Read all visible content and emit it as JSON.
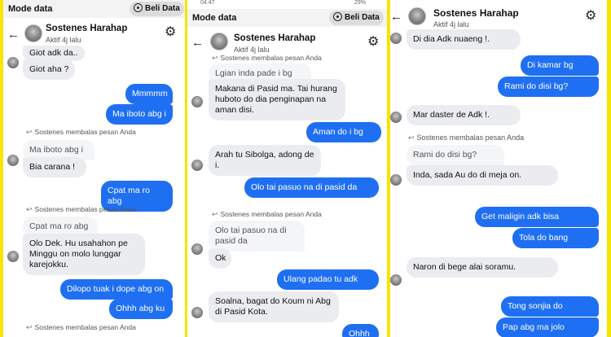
{
  "topbar": {
    "mode_label": "Mode data",
    "data_button": "Beli Data",
    "clipped_time": "04.47",
    "clipped_battery": "29%"
  },
  "contact": {
    "name": "Sostenes Harahap",
    "status": "Aktif 4j lalu"
  },
  "reply_label": "Sostenes membalas pesan Anda",
  "panel1": {
    "messages": [
      {
        "text": "Giot adk da..",
        "side": "in"
      },
      {
        "text": "Giot aha ?",
        "side": "in"
      },
      {
        "text": "Mmmmm",
        "side": "out"
      },
      {
        "text": "Ma iboto abg i",
        "side": "out"
      },
      {
        "text": "Ma iboto abg i",
        "side": "quote"
      },
      {
        "text": "Bia carana !",
        "side": "in"
      },
      {
        "text": "Cpat ma ro abg",
        "side": "out"
      },
      {
        "text": "Cpat ma ro abg",
        "side": "quote"
      },
      {
        "text": "Olo Dek. Hu usahahon pe Minggu on molo lunggar karejokku.",
        "side": "in"
      },
      {
        "text": "Dilopo tuak i dope abg on",
        "side": "out"
      },
      {
        "text": "Ohhh abg ku",
        "side": "out"
      }
    ]
  },
  "panel2": {
    "messages": [
      {
        "text": "Lgian inda pade i bg",
        "side": "quote"
      },
      {
        "text": "Makana di Pasid ma. Tai hurang huboto do dia penginapan na aman disi.",
        "side": "in"
      },
      {
        "text": "Aman do i bg",
        "side": "out"
      },
      {
        "text": "Arah tu Sibolga, adong de i.",
        "side": "in"
      },
      {
        "text": "Olo tai pasuo na di pasid da",
        "side": "out"
      },
      {
        "text": "Olo tai pasuo na di pasid da",
        "side": "quote"
      },
      {
        "text": "Ok",
        "side": "in"
      },
      {
        "text": "Ulang padao tu adk",
        "side": "out"
      },
      {
        "text": "Soalna, bagat do Koum ni Abg di Pasid Kota.",
        "side": "in"
      },
      {
        "text": "Ohhh",
        "side": "out"
      }
    ]
  },
  "panel3": {
    "messages": [
      {
        "text": "Di dia Adk nuaeng !.",
        "side": "in"
      },
      {
        "text": "Di kamar bg",
        "side": "out"
      },
      {
        "text": "Rami do disi bg?",
        "side": "out"
      },
      {
        "text": "Mar daster de Adk !.",
        "side": "in"
      },
      {
        "text": "Rami do disi bg?",
        "side": "quote"
      },
      {
        "text": "Inda, sada Au do di meja on.",
        "side": "in"
      },
      {
        "text": "Get maligin adk bisa",
        "side": "out"
      },
      {
        "text": "Tola do bang",
        "side": "out"
      },
      {
        "text": "Naron di bege alai soramu.",
        "side": "in"
      },
      {
        "text": "Tong sonjia do",
        "side": "out"
      },
      {
        "text": "Pap abg ma jolo",
        "side": "out"
      }
    ]
  }
}
